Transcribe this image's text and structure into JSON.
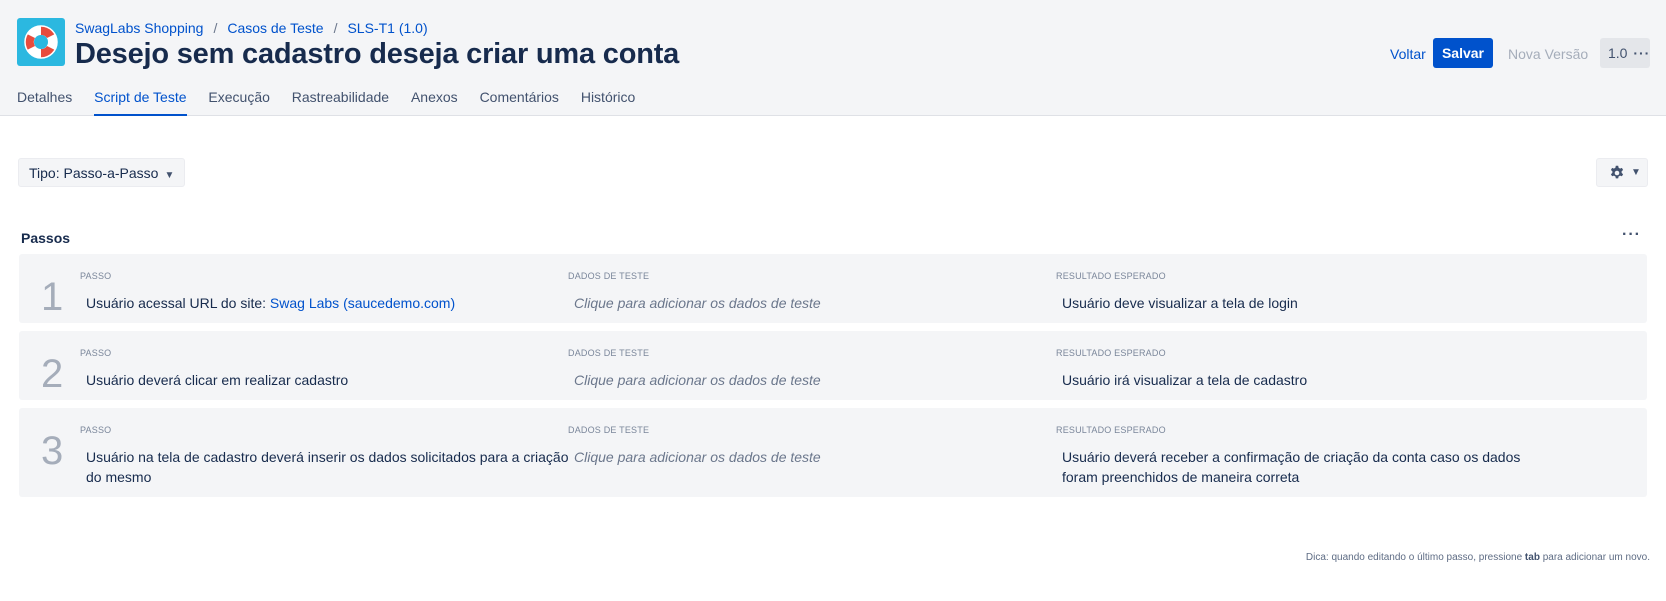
{
  "breadcrumb": {
    "project": "SwagLabs Shopping",
    "section": "Casos de Teste",
    "key": "SLS-T1 (1.0)"
  },
  "title": "Desejo sem cadastro deseja criar uma conta",
  "actions": {
    "back": "Voltar",
    "save": "Salvar",
    "new_version": "Nova Versão",
    "version": "1.0"
  },
  "tabs": [
    {
      "label": "Detalhes"
    },
    {
      "label": "Script de Teste",
      "active": true
    },
    {
      "label": "Execução"
    },
    {
      "label": "Rastreabilidade"
    },
    {
      "label": "Anexos"
    },
    {
      "label": "Comentários"
    },
    {
      "label": "Histórico"
    }
  ],
  "toolbar": {
    "type_label": "Tipo: Passo-a-Passo",
    "settings_icon": "gear-icon"
  },
  "steps_section": {
    "title": "Passos",
    "columns": {
      "step": "PASSO",
      "data": "DADOS DE TESTE",
      "expected": "RESULTADO ESPERADO"
    },
    "steps": [
      {
        "number": "1",
        "step_text": "Usuário acessal URL do site: ",
        "step_link": "Swag Labs (saucedemo.com)",
        "data": "Clique para adicionar os dados de teste",
        "expected": "Usuário deve visualizar a tela de login"
      },
      {
        "number": "2",
        "step_text": "Usuário deverá clicar em realizar cadastro",
        "data": "Clique para adicionar os dados de teste",
        "expected": "Usuário irá visualizar a tela de cadastro"
      },
      {
        "number": "3",
        "step_text": "Usuário na tela de cadastro deverá inserir os dados solicitados para a criação do mesmo",
        "data": "Clique para adicionar os dados de teste",
        "expected": "Usuário deverá receber a confirmação de criação da conta caso os dados foram preenchidos de maneira correta"
      }
    ]
  },
  "hint": {
    "prefix": "Dica: quando editando o último passo, pressione ",
    "key": "tab",
    "suffix": " para adicionar um novo."
  },
  "colors": {
    "accent": "#0052cc",
    "header_bg": "#f4f5f7",
    "logo_bg": "#2bb8e0"
  }
}
